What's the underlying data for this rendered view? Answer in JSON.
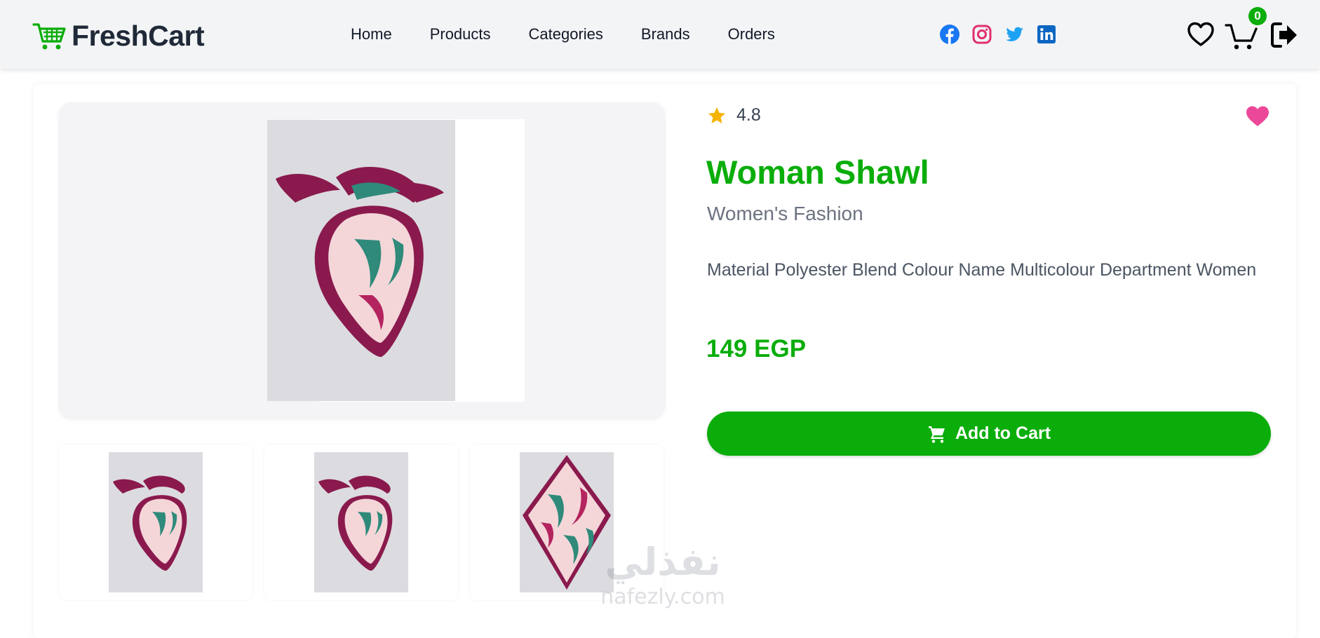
{
  "brand": {
    "name": "FreshCart",
    "logo_icon": "shopping-cart-icon",
    "accent_color": "#0aad0a"
  },
  "nav": {
    "links": [
      {
        "label": "Home"
      },
      {
        "label": "Products"
      },
      {
        "label": "Categories"
      },
      {
        "label": "Brands"
      },
      {
        "label": "Orders"
      }
    ],
    "social_icons": [
      "facebook-icon",
      "instagram-icon",
      "twitter-icon",
      "linkedin-icon"
    ],
    "cart_count": "0",
    "action_icons": [
      "heart-icon",
      "cart-icon",
      "logout-icon"
    ]
  },
  "product": {
    "rating": "4.8",
    "title": "Woman Shawl",
    "category": "Women's Fashion",
    "description": "Material Polyester Blend Colour Name Multicolour Department Women",
    "price": "149 EGP",
    "add_to_cart_label": "Add to Cart",
    "wishlist_color": "#ec4899",
    "thumbnail_count": 3
  },
  "watermark": {
    "arabic": "نفذلي",
    "latin": "nafezly.com"
  }
}
